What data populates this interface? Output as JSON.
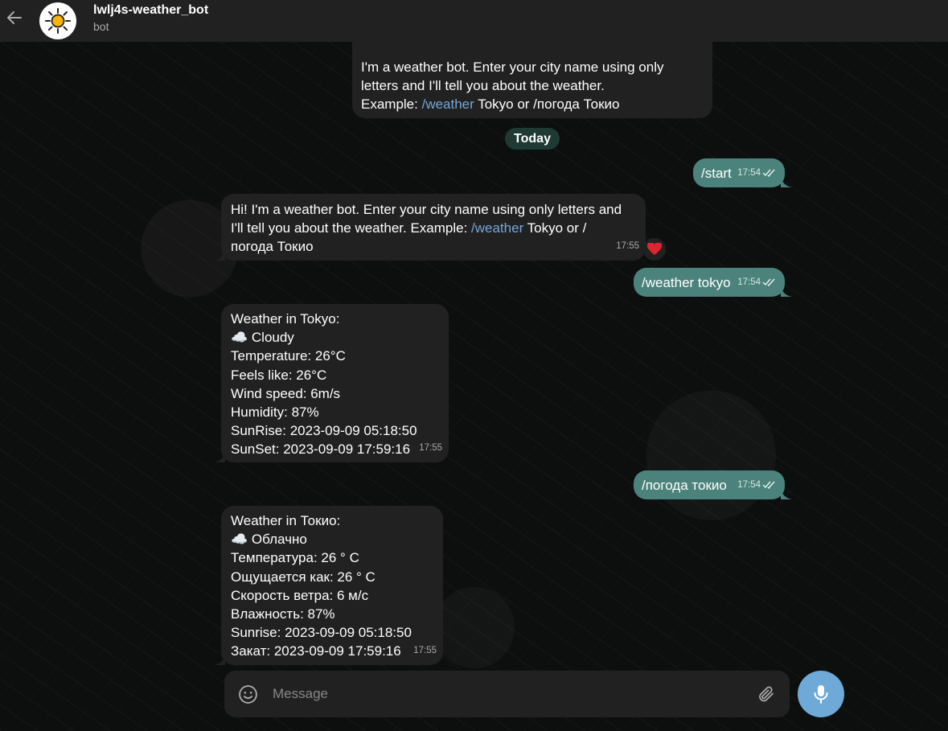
{
  "header": {
    "title": "lwlj4s-weather_bot",
    "subtitle": "bot"
  },
  "messages": {
    "m0": {
      "line1": "I'm a weather bot. Enter your city name using only",
      "line2": "letters and I'll tell you about the weather.",
      "line3_pre": "Example: ",
      "line3_link": "/weather",
      "line3_post": " Tokyo or  /погода Токио"
    },
    "date_separator": "Today",
    "m1": {
      "text": "/start",
      "time": "17:54"
    },
    "m2": {
      "line1_pre": "Hi! I'm a weather bot. Enter your city name using only letters and",
      "line2_pre": "I'll tell you about the weather. Example: ",
      "line2_link": "/weather",
      "line2_post": " Tokyo or /",
      "line3": "погода Токио",
      "time": "17:55",
      "reaction": "❤️"
    },
    "m3": {
      "text": "/weather tokyo",
      "time": "17:54"
    },
    "m4": {
      "lines": [
        "Weather in Tokyo:",
        "☁️ Cloudy",
        "Temperature: 26°C",
        "Feels like: 26°C",
        "Wind speed: 6m/s",
        "Humidity: 87%",
        "SunRise: 2023-09-09 05:18:50",
        "SunSet: 2023-09-09 17:59:16"
      ],
      "time": "17:55"
    },
    "m5": {
      "text": "/погода токио",
      "time": "17:54"
    },
    "m6": {
      "lines": [
        "Weather in Токио:",
        "☁️ Облачно",
        "Температура: 26 ° C",
        "Ощущается как: 26 ° C",
        "Скорость ветра: 6 м/с",
        "Влажность: 87%",
        "Sunrise: 2023-09-09 05:18:50",
        "Закат: 2023-09-09 17:59:16"
      ],
      "time": "17:55"
    }
  },
  "composer": {
    "placeholder": "Message"
  },
  "colors": {
    "outgoing_bubble": "#4b837c",
    "incoming_bubble": "#212121",
    "link": "#74a7d7",
    "mic_button": "#6ea9d7"
  },
  "icons": [
    "back-arrow-icon",
    "sun-avatar-icon",
    "double-check-icon",
    "heart-icon",
    "emoji-icon",
    "paperclip-icon",
    "microphone-icon"
  ]
}
